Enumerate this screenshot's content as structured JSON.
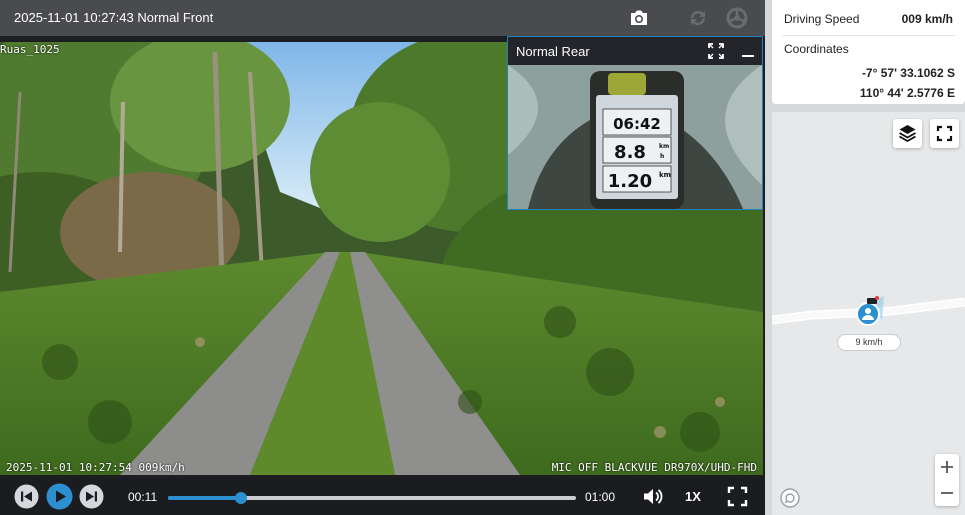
{
  "player": {
    "title": "2025-11-01 10:27:43 Normal Front",
    "camera_name": "Ruas_1025",
    "overlay_left": "2025-11-01 10:27:54 009km/h",
    "overlay_right": "MIC OFF BLACKVUE DR970X/UHD-FHD",
    "icons": [
      "camera-icon",
      "sync-icon",
      "wheel-icon"
    ]
  },
  "rear": {
    "title": "Normal Rear",
    "gps_time": "06:42",
    "gps_speed": "8.8",
    "gps_distance": "1.20",
    "unit_kmh_top": "km",
    "unit_kmh_bottom": "h",
    "unit_km": "km"
  },
  "controls": {
    "current_time": "00:11",
    "total_time": "01:00",
    "progress": 0.18,
    "speed": "1X",
    "icons": [
      "prev-icon",
      "play-icon",
      "next-icon",
      "volume-icon",
      "fullscreen-icon"
    ]
  },
  "info": {
    "speed_label": "Driving Speed",
    "speed_value": "009 km/h",
    "coord_label": "Coordinates",
    "latitude": "-7° 57' 33.1062 S",
    "longitude": "110° 44' 2.5776 E"
  },
  "map": {
    "marker_speed": "9 km/h",
    "accent_color": "#2b8fd0"
  }
}
